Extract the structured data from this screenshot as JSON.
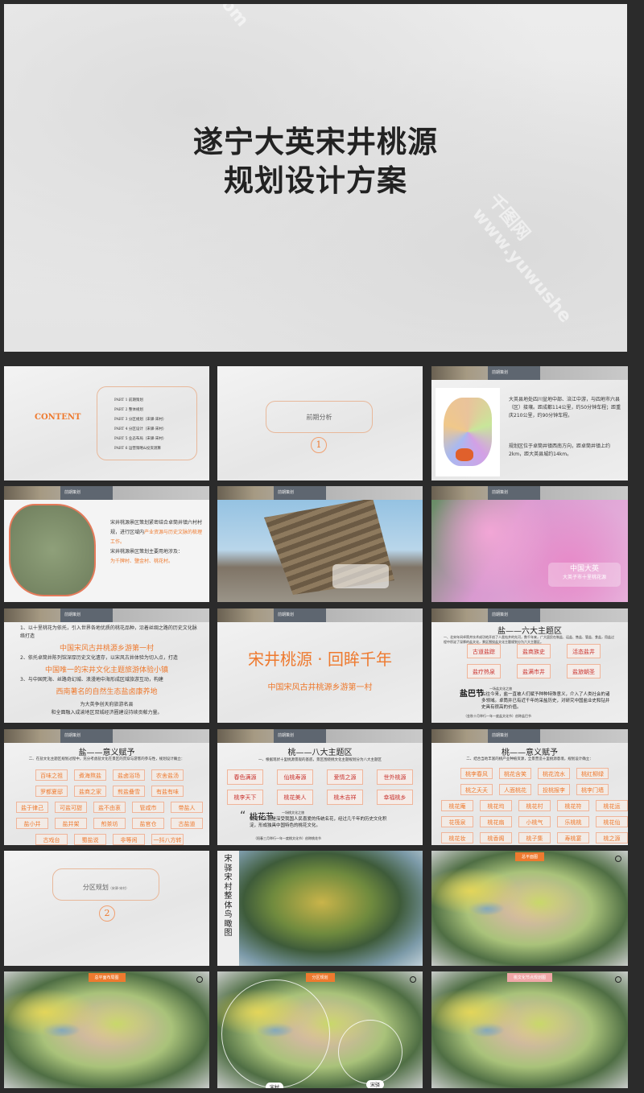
{
  "cover": {
    "title_line1": "遂宁大英宋井桃源",
    "title_line2": "规划设计方案"
  },
  "contents": {
    "heading": "CONTENT",
    "parts": [
      "PART 1  前期策划",
      "PART 2  整体规划",
      "PART 3  分区规划（宋驿·宋村）",
      "PART 4  分区设计（宋驿·宋村）",
      "PART 5  业态布局（宋驿·宋村）",
      "PART 6  运营策略&投资测算"
    ]
  },
  "section1": {
    "title": "前期分析",
    "number": "1"
  },
  "header_tab": "前期策划",
  "location": {
    "p1": "大英县地处四川盆地中部、涪江中游，与四地市六县（区）接壤。距成都114公里，约50分钟车程；距重庆210公里，约90分钟车程。",
    "p2": "规划区位于卓筒井镇西南方向，距卓筒井镇上约2km，距大英县城约14km。"
  },
  "villages": {
    "p1": "宋井桃源景区策划紧密结合卓筒井镇六村村规，进行区域内",
    "p1_hl": "产业资源与历史文脉的梳理工作。",
    "p2": "宋井桃源景区策划主要用地涉及：",
    "p2_hl": "为千牌村、鹽金村、桃花村。"
  },
  "peach_photo": {
    "line1": "中国大英",
    "line2": "大英子市十里桃花源"
  },
  "positioning": {
    "p1": "1、以十里桃花为依托，引入世界各地优质的桃花品种，沿着丝绸之路的历史文化脉络打造",
    "h1": "中国宋风古井桃源乡游第一村",
    "p2": "2、依托卓筒井陈列馆深厚历史文化遗存，以宋风古井体验为切入点，打造",
    "h2": "中国唯一的宋井文化主题旅游体验小镇",
    "p3": "3、与中国死海、丝路奇幻城、浪漫地中海形成区域旅游互动，构建",
    "h3": "西南著名的自然生态盐卤康养地",
    "foot1": "为大英争创天府旅游名县",
    "foot2": "和全面融入成渝地区双城经济圈建设持续贡献力量。"
  },
  "slogan": {
    "title": "宋井桃源 · 回眸千年",
    "subtitle": "中国宋风古井桃源乡游第一村"
  },
  "salt_zones": {
    "title": "盐——六大主题区",
    "intro": "一、北宋年间卓筒井技术成功地开创了人类钻井的先河，数千年来，广大居民在制盐、运盐、售盐、管盐、食盐，用盐过程中积淀了深厚的盐文化，景区围绕盐文化主题规划分为六大主题区。",
    "zones": [
      "古道盐踪",
      "盐商族史",
      "活态盐井",
      "盐疗热泉",
      "盐满市井",
      "盐旅朝圣"
    ],
    "fest": "盐巴节",
    "fest_sub": "一场盐文化之旅",
    "fest_text": "古往今来，盐一直被人们赋予种种特殊意义，介入了人类社会的诸多领域。卓筒井已有近千年的采盐历史，对研究中国盐业史和钻井史具有很高的价值。",
    "fest_note": "（金秋十月举行一年一度盐文化节）创称盐巴节"
  },
  "salt_meaning": {
    "title": "盐——意义赋予",
    "intro": "二、在盐文化主题区规划过程中，充分考虑盐文化在景区的贯穿与游客的参与性，规划设计确立：",
    "items": [
      "百味之祖",
      "煮海熬盐",
      "盐卤浴场",
      "农舍盐汤",
      "罗都夏邸",
      "盐商之家",
      "煎盐叠雪",
      "有盐有味",
      "盐于律己",
      "可盐可甜",
      "盐不由衷",
      "管咸市",
      "带盐人",
      "盐小井",
      "盐井架",
      "煎茶坊",
      "盐官仓",
      "古盐道",
      "古戏台",
      "蜀盐说",
      "非等闲",
      "一抖八方转"
    ]
  },
  "peach_zones": {
    "title": "桃——八大主题区",
    "intro": "一、根据现状十里桃源景观的基底，景区围绕桃文化主题规划分为八大主题区",
    "zones": [
      "春色满源",
      "仙桃寿源",
      "爱情之源",
      "世外桃源",
      "桃李天下",
      "桃花美人",
      "桃木吉祥",
      "幸福桃乡"
    ],
    "fest": "桃花节",
    "fest_sub": "一场桃文化之旅",
    "fest_text": "桃花自古就是深受我国人民喜爱的传统名花，经过几千年的历史文化积淀，形成独具中国特色的桃花文化。",
    "fest_note": "（阳春三月举行一年一度桃文化节）创称桃花节"
  },
  "peach_meaning": {
    "title": "桃——意义赋予",
    "intro": "二、结合当地丰富的桃产业种植资源，全景营造十里桃源意境，规划设计确立：",
    "items": [
      "桃李春风",
      "桃花含笑",
      "桃花流水",
      "桃红柳绿",
      "桃之夭夭",
      "人面桃花",
      "投桃报李",
      "桃李门墙",
      "桃花庵",
      "桃花坞",
      "桃花村",
      "桃花符",
      "桃花运",
      "花筏泉",
      "桃花扇",
      "小桃气",
      "乐桃桃",
      "桃花仙",
      "桃花妆",
      "桃香阁",
      "桃子集",
      "寿桃宴",
      "桃之源"
    ]
  },
  "section2": {
    "title": "分区规划",
    "title_sub": "（宋驿·宋村）",
    "number": "2"
  },
  "aerial": {
    "vertical_title": "宋驿宋村整体鸟瞰图"
  },
  "plan_labels": [
    "总平面图",
    "总平面布局图",
    "分区规划",
    "桃文化节点规划图"
  ],
  "zone_labels": [
    "宋村",
    "宋驿"
  ],
  "colors": {
    "accent": "#ee7a2f",
    "red": "#c9332f",
    "bg": "#2b2b2b"
  }
}
